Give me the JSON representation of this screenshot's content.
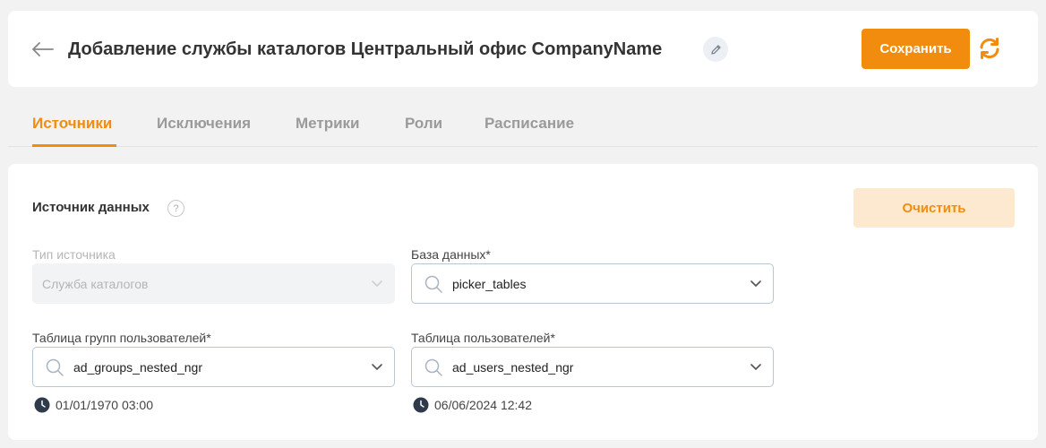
{
  "header": {
    "title": "Добавление службы каталогов Центральный офис CompanyName",
    "save_label": "Сохранить"
  },
  "tabs": [
    {
      "label": "Источники",
      "active": true
    },
    {
      "label": "Исключения",
      "active": false
    },
    {
      "label": "Метрики",
      "active": false
    },
    {
      "label": "Роли",
      "active": false
    },
    {
      "label": "Расписание",
      "active": false
    }
  ],
  "section": {
    "title": "Источник данных",
    "help": "?",
    "clear_label": "Очистить"
  },
  "fields": {
    "source_type": {
      "label": "Тип источника",
      "value": "Служба каталогов"
    },
    "database": {
      "label": "База данных*",
      "value": "picker_tables"
    },
    "groups_table": {
      "label": "Таблица групп пользователей*",
      "value": "ad_groups_nested_ngr",
      "timestamp": "01/01/1970 03:00"
    },
    "users_table": {
      "label": "Таблица пользователей*",
      "value": "ad_users_nested_ngr",
      "timestamp": "06/06/2024 12:42"
    }
  },
  "colors": {
    "accent": "#f28c0f",
    "accent_light": "#fde9cf",
    "inactive_tab": "#9a9a9a"
  }
}
